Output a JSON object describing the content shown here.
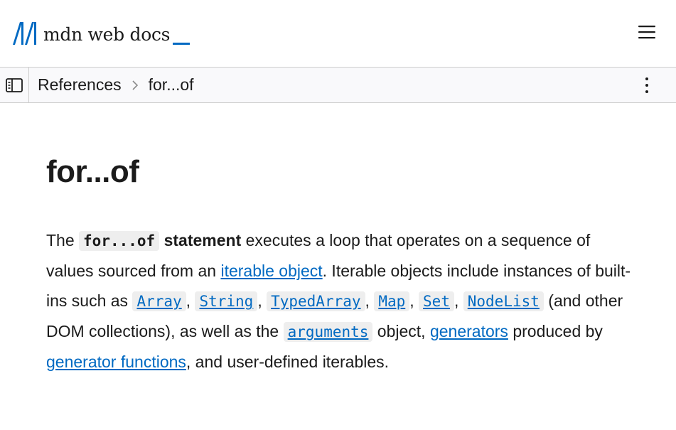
{
  "header": {
    "logo_text": "mdn web docs",
    "menu_icon": "hamburger-menu-icon"
  },
  "breadcrumb": {
    "sidebar_icon": "sidebar-toggle-icon",
    "items": [
      "References",
      "for...of"
    ],
    "separator_icon": "chevron-right-icon",
    "more_icon": "vertical-ellipsis-icon"
  },
  "article": {
    "title": "for...of",
    "intro": {
      "t1": "The ",
      "code_forof": "for...of",
      "strong": "statement",
      "t2": " executes a loop that operates on a sequence of values sourced from an ",
      "link_iterable": "iterable object",
      "t3": ". Iterable objects include instances of built-ins such as ",
      "code_array": "Array",
      "sep1": ", ",
      "code_string": "String",
      "sep2": ", ",
      "code_typedarray": "TypedArray",
      "sep3": ", ",
      "code_map": "Map",
      "sep4": ", ",
      "code_set": "Set",
      "sep5": ", ",
      "code_nodelist": "NodeList",
      "t4": " (and other DOM collections), as well as the ",
      "code_arguments": "arguments",
      "t5": " object, ",
      "link_generators": "generators",
      "t6": " produced by ",
      "link_generator_functions": "generator functions",
      "t7": ", and user-defined iterables."
    }
  },
  "colors": {
    "link": "#0069c2",
    "text": "#1b1b1b",
    "code_bg": "#eeeeee",
    "bar_bg": "#f9f9fb",
    "border": "#cdcdcd"
  }
}
